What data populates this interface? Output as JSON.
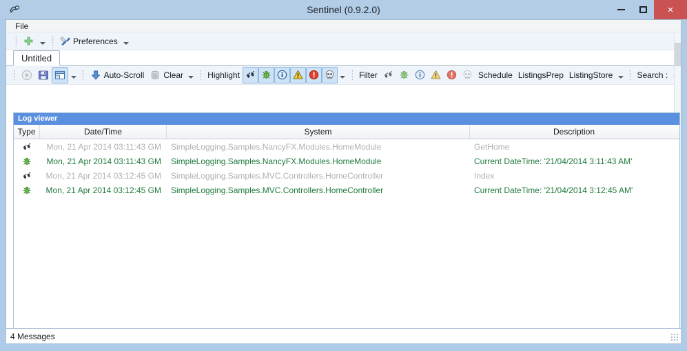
{
  "window": {
    "title": "Sentinel (0.9.2.0)",
    "app_icon": "sentinel-icon",
    "minimize_label": "Minimize",
    "maximize_label": "Maximize",
    "close_label": "Close",
    "close_glyph": "×",
    "accent_blue": "#5b8fe0",
    "title_bar_color": "#b3cde6",
    "close_button_color": "#cb5252"
  },
  "menubar": {
    "items": [
      {
        "label": "File"
      }
    ]
  },
  "ribbon": {
    "add_icon": "plus-icon",
    "add_dropdown": "chevron-down-icon",
    "preferences_label": "Preferences",
    "preferences_icon": "tools-icon",
    "preferences_dropdown": "chevron-down-icon"
  },
  "tabs": {
    "items": [
      {
        "label": "Untitled",
        "active": true
      }
    ]
  },
  "toolbar": {
    "groups": [
      {
        "name": "session",
        "buttons": [
          {
            "label": "",
            "icon": "play-icon",
            "selected": false,
            "enabled": false
          },
          {
            "label": "",
            "icon": "save-icon",
            "selected": false,
            "enabled": true
          },
          {
            "label": "",
            "icon": "layout-icon",
            "selected": true,
            "enabled": true
          }
        ]
      },
      {
        "name": "view",
        "buttons": [
          {
            "label": "Auto-Scroll",
            "icon": "down-arrow-icon",
            "selected": false,
            "enabled": true
          },
          {
            "label": "Clear",
            "icon": "trash-icon",
            "selected": false,
            "enabled": true
          }
        ]
      },
      {
        "name": "highlight",
        "label": "Highlight",
        "buttons": [
          {
            "label": "",
            "icon": "footprints-icon",
            "selected": true,
            "enabled": true
          },
          {
            "label": "",
            "icon": "bug-icon",
            "selected": true,
            "enabled": true
          },
          {
            "label": "",
            "icon": "info-icon",
            "selected": true,
            "enabled": true
          },
          {
            "label": "",
            "icon": "warning-icon",
            "selected": true,
            "enabled": true
          },
          {
            "label": "",
            "icon": "error-icon",
            "selected": true,
            "enabled": true
          },
          {
            "label": "",
            "icon": "skull-icon",
            "selected": true,
            "enabled": true
          }
        ]
      },
      {
        "name": "filter",
        "label": "Filter",
        "buttons": [
          {
            "label": "",
            "icon": "footprints-icon",
            "selected": false,
            "enabled": true
          },
          {
            "label": "",
            "icon": "bug-icon",
            "selected": false,
            "enabled": true
          },
          {
            "label": "",
            "icon": "info-icon",
            "selected": false,
            "enabled": true
          },
          {
            "label": "",
            "icon": "warning-icon",
            "selected": false,
            "enabled": true
          },
          {
            "label": "",
            "icon": "error-icon",
            "selected": false,
            "enabled": true
          },
          {
            "label": "",
            "icon": "skull-icon",
            "selected": false,
            "enabled": true
          }
        ]
      },
      {
        "name": "named-filters",
        "buttons": [
          {
            "label": "Schedule",
            "selected": false,
            "enabled": true
          },
          {
            "label": "ListingsPrep",
            "selected": false,
            "enabled": true
          },
          {
            "label": "ListingStore",
            "selected": false,
            "enabled": true
          }
        ]
      },
      {
        "name": "search",
        "label": "Search :"
      }
    ]
  },
  "log_viewer": {
    "pane_title": "Log viewer",
    "columns": [
      {
        "key": "type",
        "label": "Type"
      },
      {
        "key": "date",
        "label": "Date/Time"
      },
      {
        "key": "system",
        "label": "System"
      },
      {
        "key": "description",
        "label": "Description"
      }
    ],
    "rows": [
      {
        "type": "trace",
        "type_icon": "footprints-icon",
        "date": "Mon, 21 Apr 2014 03:11:43 GM",
        "system": "SimpleLogging.Samples.NancyFX.Modules.HomeModule",
        "description": "GetHome"
      },
      {
        "type": "debug",
        "type_icon": "bug-icon",
        "date": "Mon, 21 Apr 2014 03:11:43 GM",
        "system": "SimpleLogging.Samples.NancyFX.Modules.HomeModule",
        "description": "Current DateTime: '21/04/2014 3:11:43 AM'"
      },
      {
        "type": "trace",
        "type_icon": "footprints-icon",
        "date": "Mon, 21 Apr 2014 03:12:45 GM",
        "system": "SimpleLogging.Samples.MVC.Controllers.HomeController",
        "description": "Index"
      },
      {
        "type": "debug",
        "type_icon": "bug-icon",
        "date": "Mon, 21 Apr 2014 03:12:45 GM",
        "system": "SimpleLogging.Samples.MVC.Controllers.HomeController",
        "description": "Current DateTime: '21/04/2014 3:12:45 AM'"
      }
    ],
    "scroll": {
      "left_arrow": "‹",
      "right_arrow": "›"
    }
  },
  "statusbar": {
    "message_count_text": "4 Messages"
  }
}
